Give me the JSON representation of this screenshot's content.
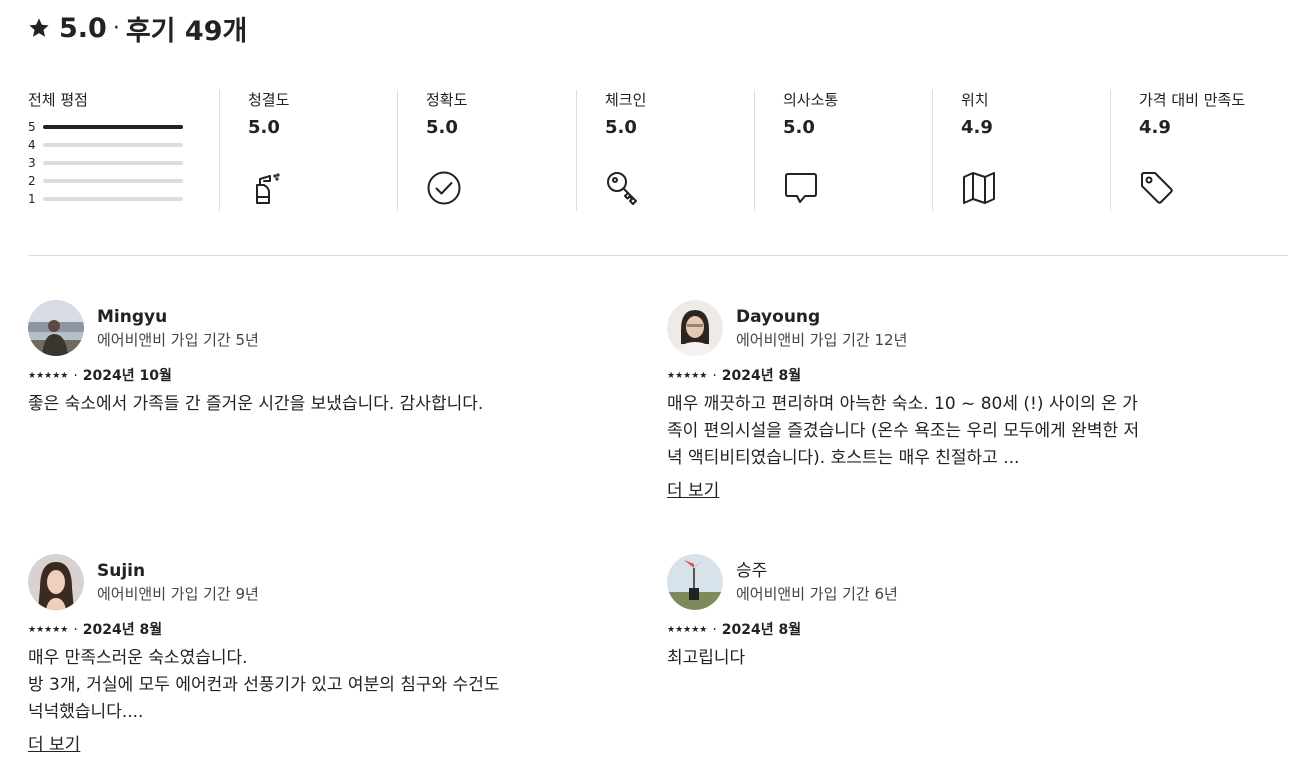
{
  "header": {
    "rating": "5.0",
    "dot": "·",
    "reviews_label": "후기 49개"
  },
  "overall": {
    "title": "전체 평점",
    "bars": [
      {
        "label": "5",
        "fraction": 1.0
      },
      {
        "label": "4",
        "fraction": 0.0
      },
      {
        "label": "3",
        "fraction": 0.0
      },
      {
        "label": "2",
        "fraction": 0.0
      },
      {
        "label": "1",
        "fraction": 0.0
      }
    ]
  },
  "categories": [
    {
      "title": "청결도",
      "value": "5.0",
      "icon": "spray-bottle-icon"
    },
    {
      "title": "정확도",
      "value": "5.0",
      "icon": "check-circle-icon"
    },
    {
      "title": "체크인",
      "value": "5.0",
      "icon": "key-icon"
    },
    {
      "title": "의사소통",
      "value": "5.0",
      "icon": "chat-bubble-icon"
    },
    {
      "title": "위치",
      "value": "4.9",
      "icon": "map-icon"
    },
    {
      "title": "가격 대비 만족도",
      "value": "4.9",
      "icon": "tag-icon"
    }
  ],
  "reviews": [
    {
      "name": "Mingyu",
      "member": "에어비앤비 가입 기간 5년",
      "stars": "★★★★★",
      "date": "2024년 10월",
      "text": "좋은 숙소에서 가족들 간 즐거운 시간을 보냈습니다. 감사합니다.",
      "more": ""
    },
    {
      "name": "Dayoung",
      "member": "에어비앤비 가입 기간 12년",
      "stars": "★★★★★",
      "date": "2024년 8월",
      "text": "매우 깨끗하고 편리하며 아늑한 숙소. 10 ~ 80세 (!) 사이의 온 가족이 편의시설을 즐겼습니다 (온수 욕조는 우리 모두에게 완벽한 저녁 액티비티였습니다). 호스트는 매우 친절하고 ...",
      "more": "더 보기"
    },
    {
      "name": "Sujin",
      "member": "에어비앤비 가입 기간 9년",
      "stars": "★★★★★",
      "date": "2024년 8월",
      "text": "매우 만족스러운 숙소였습니다.\n방 3개, 거실에 모두 에어컨과 선풍기가 있고 여분의 침구와 수건도 넉넉했습니다....",
      "more": "더 보기"
    },
    {
      "name": "승주",
      "member": "에어비앤비 가입 기간 6년",
      "stars": "★★★★★",
      "date": "2024년 8월",
      "text": "최고립니다",
      "more": ""
    }
  ],
  "colors": {
    "text": "#222222",
    "muted": "#444444",
    "divider": "#dddddd"
  }
}
